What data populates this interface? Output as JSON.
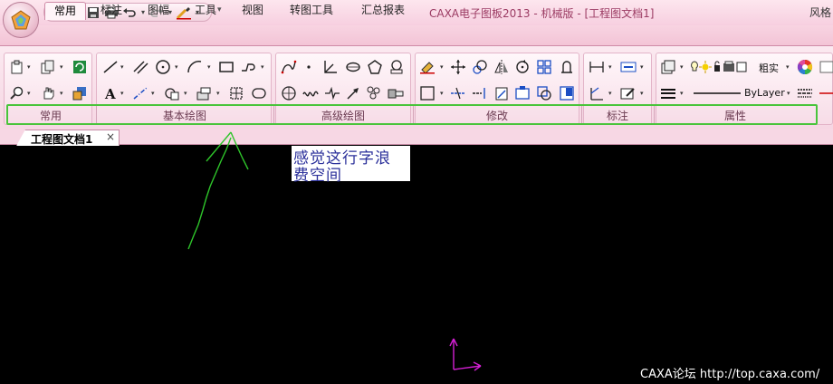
{
  "titlebar": {
    "window_title": "CAXA电子图板2013 - 机械版 - [工程图文档1]",
    "qat_customize_glyph": "▾"
  },
  "ribbon_tabs": [
    "常用",
    "标注",
    "图幅",
    "工具",
    "视图",
    "转图工具",
    "汇总报表"
  ],
  "ribbon_tab_right": "风格",
  "active_tab": "常用",
  "groups": [
    "常用",
    "基本绘图",
    "高级绘图",
    "修改",
    "标注",
    "属性"
  ],
  "properties": {
    "lineweight_label": "粗实",
    "linetype_label": "ByLayer"
  },
  "document_tab": {
    "label": "工程图文档1",
    "close_glyph": "×"
  },
  "annotation": {
    "line1": "感觉这行字浪",
    "line2": "费空间"
  },
  "watermark": "CAXA论坛 http://top.caxa.com/",
  "colors": {
    "ribbon_accent": "#f3c4d6",
    "highlight_box": "#49c43b",
    "annotation_text": "#2a2f9a",
    "arrow_stroke": "#2ec42a",
    "ucs_axis": "#d21fd2",
    "canvas_bg": "#000000"
  },
  "icons": {
    "qat": [
      "new-icon",
      "open-icon",
      "save-icon",
      "print-icon",
      "undo-icon",
      "redo-icon",
      "match-properties-icon"
    ],
    "common_group": [
      "clipboard-paste-icon",
      "copy-object-icon",
      "regenerate-icon",
      "zoom-icon",
      "pan-icon",
      "layer-icon"
    ],
    "draw_group": [
      "line-icon",
      "parallel-line-icon",
      "circle-icon",
      "arc-icon",
      "rectangle-icon",
      "polyline-icon",
      "text-icon",
      "centerline-icon",
      "hatch-icon",
      "block-icon",
      "section-icon",
      "ellipse-icon"
    ],
    "advanced_group": [
      "spline-icon",
      "point-icon",
      "angle-line-icon",
      "ellipse-shape-icon",
      "polygon-icon",
      "nut-icon",
      "hole-icon",
      "wave-line-icon",
      "break-line-icon",
      "arrow-icon",
      "cloud-icon",
      "bolt-icon"
    ],
    "modify_group": [
      "erase-icon",
      "move-icon",
      "scale-icon",
      "mirror-icon",
      "rotate-icon",
      "array-icon",
      "stretch-icon",
      "select-window-icon",
      "trim-icon",
      "extend-icon",
      "break-icon",
      "explode-icon",
      "group-icon",
      "align-icon"
    ],
    "dimension_group": [
      "linear-dimension-icon",
      "text-dimension-icon",
      "coordinate-dimension-icon",
      "edit-dimension-icon"
    ],
    "property_group": [
      "layer-state-icon",
      "color-wheel-icon",
      "lineweight-icon",
      "linestyle-icon"
    ]
  }
}
